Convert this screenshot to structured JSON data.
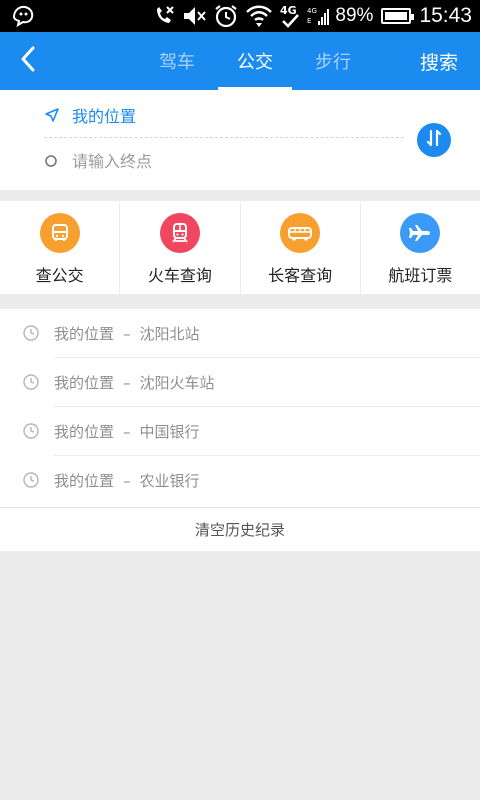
{
  "status_bar": {
    "battery_percent": "89%",
    "time": "15:43",
    "network_type": "4G",
    "icons": [
      "notification-icon",
      "mute-call-icon",
      "volume-mute-icon",
      "alarm-icon",
      "wifi-icon",
      "4g-icon",
      "signal-icon",
      "battery-icon"
    ]
  },
  "header": {
    "tabs": [
      {
        "label": "驾车",
        "active": false
      },
      {
        "label": "公交",
        "active": true
      },
      {
        "label": "步行",
        "active": false
      }
    ],
    "search_label": "搜索",
    "color": "#1b8bf0"
  },
  "route": {
    "start_text": "我的位置",
    "end_placeholder": "请输入终点",
    "end_value": ""
  },
  "services": [
    {
      "label": "查公交",
      "icon": "bus-icon",
      "color": "#f7a030"
    },
    {
      "label": "火车查询",
      "icon": "train-icon",
      "color": "#f0465f"
    },
    {
      "label": "长客查询",
      "icon": "coach-icon",
      "color": "#f7a030"
    },
    {
      "label": "航班订票",
      "icon": "airplane-icon",
      "color": "#3b9af6"
    }
  ],
  "history": {
    "items": [
      {
        "from": "我的位置",
        "sep": "–",
        "to": "沈阳北站"
      },
      {
        "from": "我的位置",
        "sep": "–",
        "to": "沈阳火车站"
      },
      {
        "from": "我的位置",
        "sep": "–",
        "to": "中国银行"
      },
      {
        "from": "我的位置",
        "sep": "–",
        "to": "农业银行"
      }
    ],
    "clear_label": "清空历史纪录"
  }
}
